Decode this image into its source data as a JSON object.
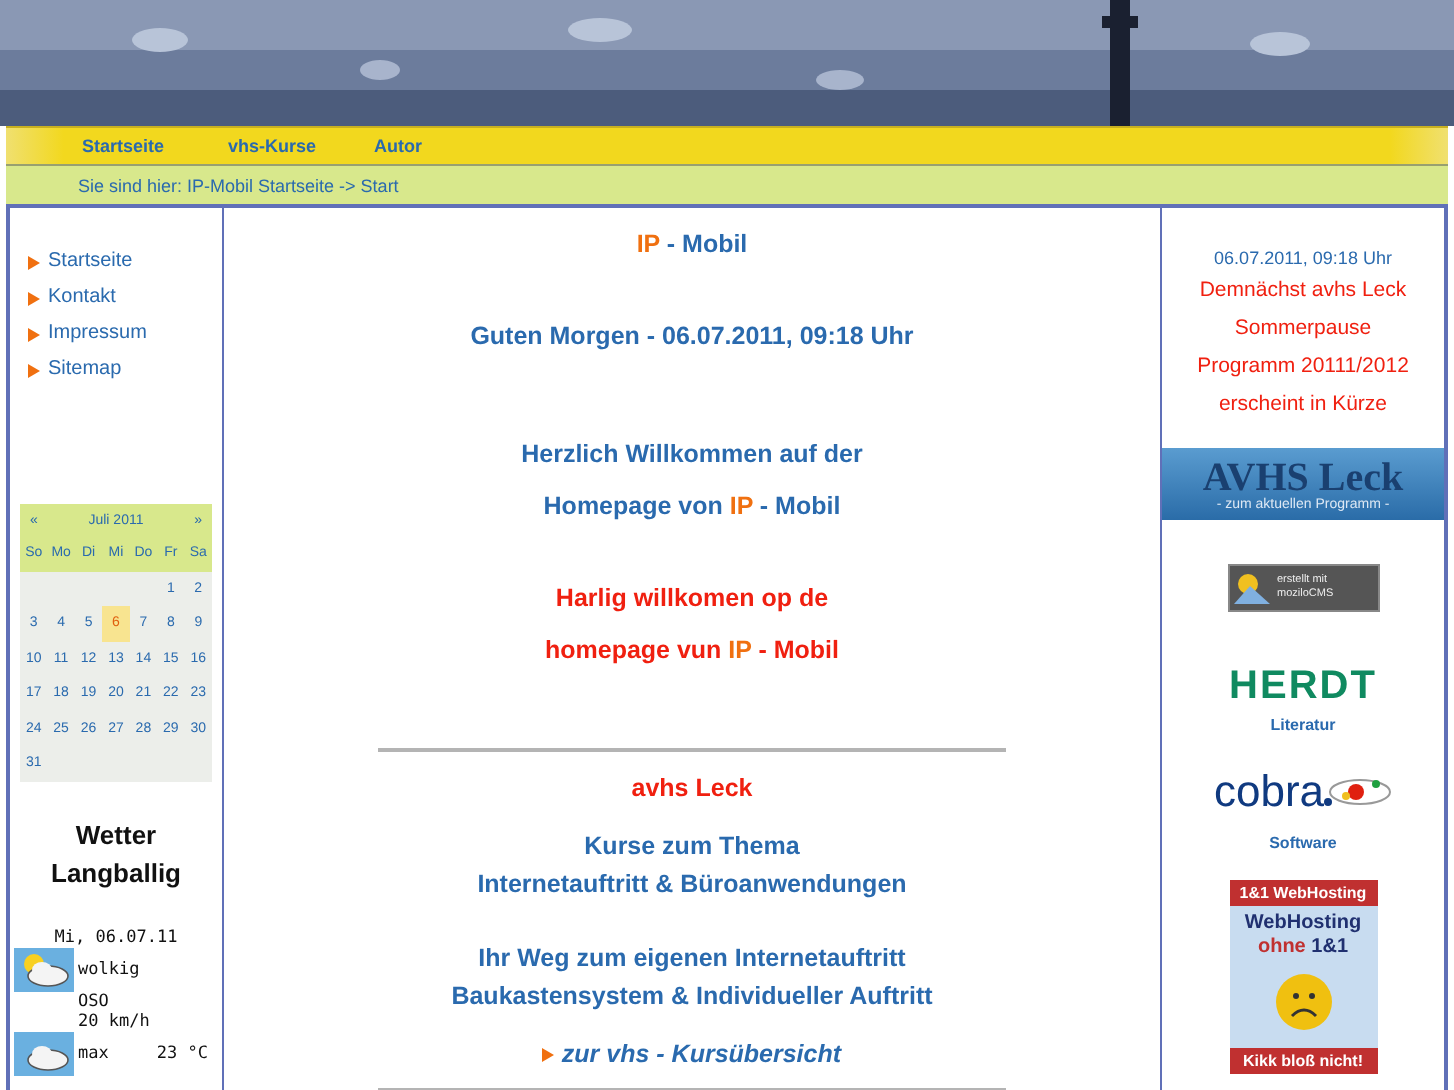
{
  "nav": [
    {
      "label": "Startseite"
    },
    {
      "label": "vhs-Kurse"
    },
    {
      "label": "Autor"
    }
  ],
  "breadcrumb": "Sie sind hier: IP-Mobil Startseite -> Start",
  "sidebar": {
    "items": [
      {
        "label": "Startseite"
      },
      {
        "label": "Kontakt"
      },
      {
        "label": "Impressum"
      },
      {
        "label": "Sitemap"
      }
    ],
    "calendar": {
      "prev": "«",
      "title": "Juli 2011",
      "next": "»",
      "weekdays": [
        "So",
        "Mo",
        "Di",
        "Mi",
        "Do",
        "Fr",
        "Sa"
      ],
      "weeks": [
        {
          "kind": "first",
          "days": [
            {
              "day": "1",
              "selected": false
            },
            {
              "day": "2",
              "selected": false
            }
          ]
        },
        {
          "kind": "week",
          "days": [
            {
              "day": "3",
              "selected": false
            },
            {
              "day": "4",
              "selected": false
            },
            {
              "day": "5",
              "selected": false
            },
            {
              "day": "6",
              "selected": true
            },
            {
              "day": "7",
              "selected": false
            },
            {
              "day": "8",
              "selected": false
            },
            {
              "day": "9",
              "selected": false
            }
          ]
        },
        {
          "kind": "week",
          "days": [
            {
              "day": "10",
              "selected": false
            },
            {
              "day": "11",
              "selected": false
            },
            {
              "day": "12",
              "selected": false
            },
            {
              "day": "13",
              "selected": false
            },
            {
              "day": "14",
              "selected": false
            },
            {
              "day": "15",
              "selected": false
            },
            {
              "day": "16",
              "selected": false
            }
          ]
        },
        {
          "kind": "week",
          "days": [
            {
              "day": "17",
              "selected": false
            },
            {
              "day": "18",
              "selected": false
            },
            {
              "day": "19",
              "selected": false
            },
            {
              "day": "20",
              "selected": false
            },
            {
              "day": "21",
              "selected": false
            },
            {
              "day": "22",
              "selected": false
            },
            {
              "day": "23",
              "selected": false
            }
          ]
        },
        {
          "kind": "week",
          "days": [
            {
              "day": "24",
              "selected": false
            },
            {
              "day": "25",
              "selected": false
            },
            {
              "day": "26",
              "selected": false
            },
            {
              "day": "27",
              "selected": false
            },
            {
              "day": "28",
              "selected": false
            },
            {
              "day": "29",
              "selected": false
            },
            {
              "day": "30",
              "selected": false
            }
          ]
        },
        {
          "kind": "week",
          "days": [
            {
              "day": "31",
              "selected": false
            }
          ]
        }
      ]
    },
    "weather": {
      "title": [
        "Wetter",
        "Langballig"
      ],
      "date": "Mi, 06.07.11",
      "condition": "wolkig",
      "wind_direction": "OSO",
      "wind_speed": "20 km/h",
      "max_label": "max",
      "max_value": "23 °C"
    }
  },
  "main": {
    "blocks": [
      {
        "kind": "title",
        "lines": [
          {
            "accent": "IP",
            "after": " - Mobil"
          }
        ]
      },
      {
        "kind": "text",
        "lines": [
          {
            "before": "Guten Morgen - 06.07.2011, 09:18 Uhr"
          }
        ]
      },
      {
        "kind": "text",
        "lines": [
          {
            "before": "Herzlich Willkommen auf der"
          },
          {
            "before": "Homepage von  ",
            "accent": "IP",
            "after": " - Mobil"
          }
        ]
      },
      {
        "kind": "notice",
        "lines": [
          {
            "before": "Harlig willkomen op de"
          },
          {
            "before": "homepage vun ",
            "accent": "IP",
            "after": " - Mobil"
          }
        ]
      },
      {
        "kind": "rule"
      },
      {
        "kind": "notice",
        "lines": [
          {
            "before": "avhs Leck"
          }
        ]
      },
      {
        "kind": "text",
        "lines": [
          {
            "before": "Kurse zum Thema"
          },
          {
            "before": "Internetauftritt & Büroanwendungen"
          }
        ]
      },
      {
        "kind": "text",
        "lines": [
          {
            "before": "Ihr Weg zum eigenen Internetauftritt"
          },
          {
            "before": "Baukastensystem & Individueller Auftritt"
          }
        ]
      },
      {
        "kind": "link",
        "lines": [
          {
            "before": "zur vhs - Kursübersicht"
          }
        ]
      },
      {
        "kind": "rule"
      }
    ]
  },
  "right": {
    "time": "06.07.2011, 09:18 Uhr",
    "notices": [
      "Demnächst avhs Leck",
      "Sommerpause",
      "Programm 20111/2012",
      "erscheint in Kürze"
    ],
    "banner": {
      "title": "AVHS Leck",
      "subtitle": "- zum aktuellen Programm -"
    },
    "cms_badge": [
      "erstellt mit",
      "moziloCMS"
    ],
    "sponsors": [
      {
        "kind": "herdt",
        "logo": "HERDT",
        "caption": "Literatur"
      },
      {
        "kind": "cobra",
        "logo": "cobra",
        "caption": "Software"
      }
    ],
    "ad": {
      "top": "1&1 WebHosting",
      "line1": "WebHosting",
      "line2_a": "ohne",
      "line2_b": "1&1",
      "bottom": "Kikk bloß nicht!"
    }
  }
}
